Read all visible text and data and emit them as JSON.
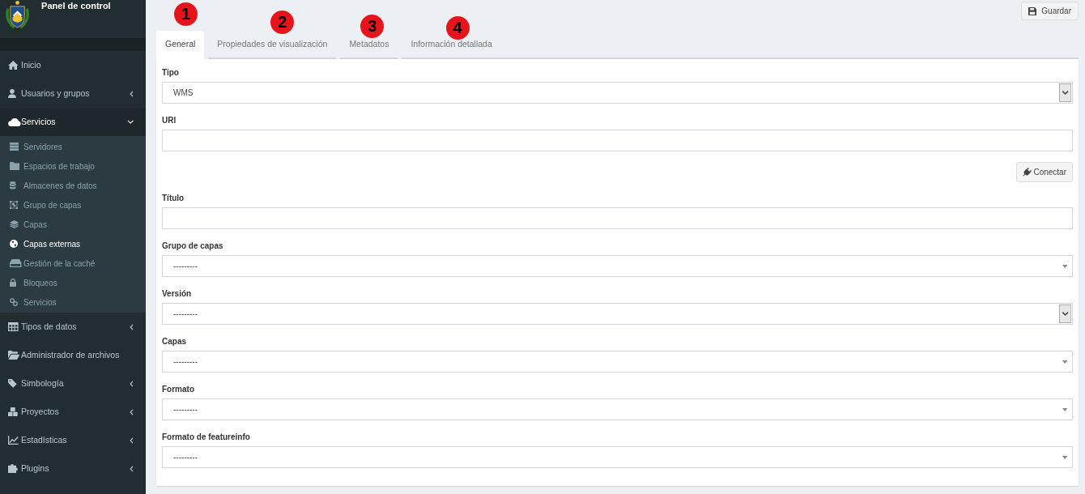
{
  "sidebar": {
    "title": "Panel de control",
    "items": [
      {
        "label": "Inicio",
        "kind": "link"
      },
      {
        "label": "Usuarios y grupos",
        "kind": "group",
        "expanded": false
      },
      {
        "label": "Servicios",
        "kind": "group",
        "expanded": true,
        "children": [
          {
            "label": "Servidores",
            "selected": false
          },
          {
            "label": "Espacios de trabajo",
            "selected": false
          },
          {
            "label": "Almacenes de datos",
            "selected": false
          },
          {
            "label": "Grupo de capas",
            "selected": false
          },
          {
            "label": "Capas",
            "selected": false
          },
          {
            "label": "Capas externas",
            "selected": true
          },
          {
            "label": "Gestión de la caché",
            "selected": false
          },
          {
            "label": "Bloqueos",
            "selected": false
          },
          {
            "label": "Servicios",
            "selected": false
          }
        ]
      },
      {
        "label": "Tipos de datos",
        "kind": "group",
        "expanded": false
      },
      {
        "label": "Administrador de archivos",
        "kind": "link"
      },
      {
        "label": "Simbología",
        "kind": "group",
        "expanded": false
      },
      {
        "label": "Proyectos",
        "kind": "group",
        "expanded": false
      },
      {
        "label": "Estadísticas",
        "kind": "group",
        "expanded": false
      },
      {
        "label": "Plugins",
        "kind": "group",
        "expanded": false
      }
    ]
  },
  "header": {
    "save_button": "Guardar"
  },
  "tabs": [
    {
      "label": "General",
      "selected": true,
      "marker": "1"
    },
    {
      "label": "Propiedades de visualización",
      "selected": false,
      "marker": "2"
    },
    {
      "label": "Metadatos",
      "selected": false,
      "marker": "3"
    },
    {
      "label": "Información detallada",
      "selected": false,
      "marker": "4"
    }
  ],
  "form": {
    "fields": [
      {
        "kind": "dropdown",
        "label": "Tipo",
        "value": "WMS"
      },
      {
        "kind": "text",
        "label": "URl"
      },
      {
        "kind": "button",
        "label": "Conectar"
      },
      {
        "kind": "text",
        "label": "Título"
      },
      {
        "kind": "picker",
        "label": "Grupo de capas",
        "value": "---------"
      },
      {
        "kind": "dropdown",
        "label": "Versión",
        "value": "---------"
      },
      {
        "kind": "picker",
        "label": "Capas",
        "value": "---------"
      },
      {
        "kind": "picker",
        "label": "Formato",
        "value": "---------"
      },
      {
        "kind": "picker",
        "label": "Formato de featureinfo",
        "value": "---------"
      }
    ]
  }
}
